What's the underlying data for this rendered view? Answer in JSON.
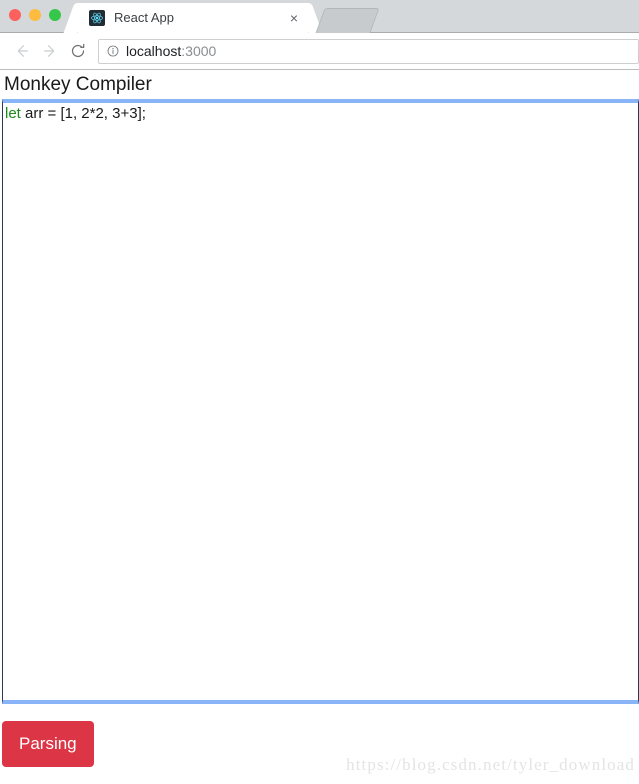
{
  "browser": {
    "window_controls": [
      {
        "name": "close",
        "color": "#fc615d"
      },
      {
        "name": "minimize",
        "color": "#fdbc40"
      },
      {
        "name": "maximize",
        "color": "#34c749"
      }
    ],
    "tab": {
      "title": "React App",
      "favicon": "react-logo-icon",
      "close_label": "×"
    },
    "toolbar": {
      "back_icon": "back-arrow-icon",
      "forward_icon": "forward-arrow-icon",
      "reload_icon": "reload-icon",
      "site_info_icon": "info-circle-icon",
      "url_host": "localhost",
      "url_port": ":3000",
      "url_full": "localhost:3000"
    }
  },
  "page": {
    "title": "Monkey Compiler",
    "editor": {
      "accent_color": "#8ab4f8",
      "border_color": "#2b3a52",
      "keyword_color": "#1a8a1a",
      "text_color": "#1a1a1a",
      "code_tokens": [
        {
          "text": "let",
          "type": "keyword"
        },
        {
          "text": " arr = [1, 2*2, 3+3];",
          "type": "plain"
        }
      ],
      "code_full": "let arr = [1, 2*2, 3+3];"
    },
    "actions": {
      "parsing_label": "Parsing",
      "parsing_color": "#dc3545"
    },
    "watermark": "https://blog.csdn.net/tyler_download"
  }
}
